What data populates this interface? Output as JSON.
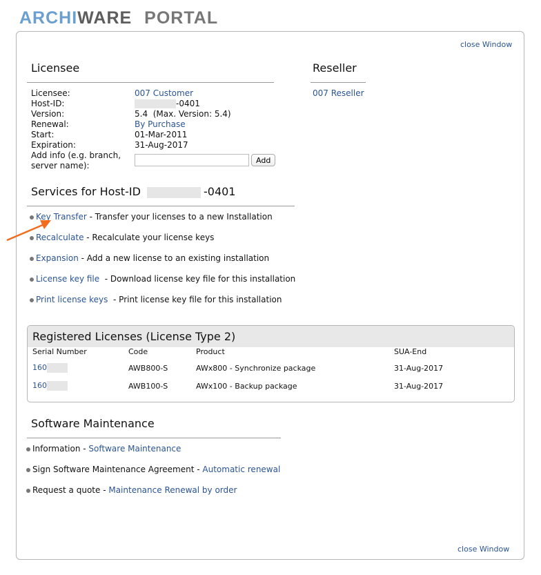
{
  "logo": {
    "part1": "ARCHI",
    "part2": "WARE",
    "part3": "PORTAL"
  },
  "close_window": "close Window",
  "licensee": {
    "title": "Licensee",
    "rows": [
      {
        "label": "Licensee:",
        "value": "007 Customer",
        "link": true
      },
      {
        "label": "Host-ID:",
        "value": "-0401",
        "masked": true
      },
      {
        "label": "Version:",
        "value": "5.4  (Max. Version: 5.4)"
      },
      {
        "label": "Renewal:",
        "value": "By Purchase",
        "link": true
      },
      {
        "label": "Start:",
        "value": "01-Mar-2011"
      },
      {
        "label": "Expiration:",
        "value": "31-Aug-2017"
      }
    ],
    "add_info_label_1": "Add info (e.g. branch,",
    "add_info_label_2": "server name):",
    "add_info_value": "",
    "add_button": "Add"
  },
  "reseller": {
    "title": "Reseller",
    "name": "007 Reseller"
  },
  "services": {
    "title_prefix": "Services for Host-ID",
    "title_suffix": "-0401",
    "items": [
      {
        "link": "Key Transfer",
        "desc": " - Transfer your licenses to a new Installation"
      },
      {
        "link": "Recalculate",
        "desc": " - Recalculate your license keys"
      },
      {
        "link": "Expansion",
        "desc": " - Add a new license to an existing installation"
      },
      {
        "link": "License key file",
        "desc": "  - Download license key file for this installation"
      },
      {
        "link": "Print license keys",
        "desc": "  - Print license key file for this installation"
      }
    ]
  },
  "registered": {
    "title": "Registered Licenses (License Type 2)",
    "columns": [
      "Serial Number",
      "Code",
      "Product",
      "SUA-End"
    ],
    "rows": [
      {
        "serial": "160",
        "code": "AWB800-S",
        "product": "AWx800 - Synchronize package",
        "sua_end": "31-Aug-2017"
      },
      {
        "serial": "160",
        "code": "AWB100-S",
        "product": "AWx100 - Backup package",
        "sua_end": "31-Aug-2017"
      }
    ]
  },
  "maintenance": {
    "title": "Software Maintenance",
    "items": [
      {
        "text": "Information - ",
        "link": "Software Maintenance"
      },
      {
        "text": "Sign Software Maintenance Agreement - ",
        "link": "Automatic renewal"
      },
      {
        "text": "Request a quote - ",
        "link": "Maintenance Renewal by order"
      }
    ]
  },
  "annotation": {
    "arrow_color": "#f26c1f",
    "target": "Key Transfer"
  }
}
